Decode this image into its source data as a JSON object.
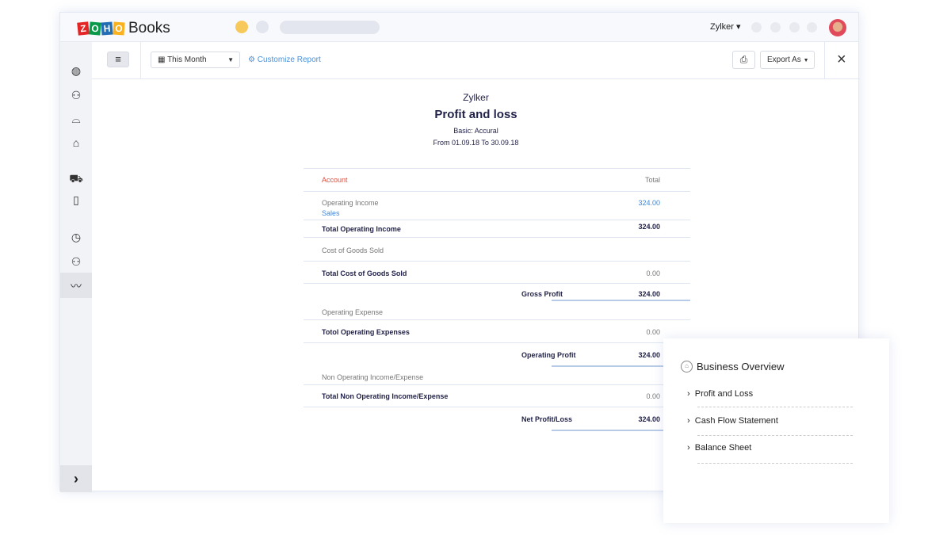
{
  "app": {
    "logo_letters": [
      "Z",
      "O",
      "H",
      "O"
    ],
    "logo_colors": [
      "#e42527",
      "#089949",
      "#226db4",
      "#f9b21d"
    ],
    "product": "Books",
    "org": "Zylker ▾"
  },
  "sidebar": {
    "icons": [
      "dashboard-icon",
      "contacts-icon",
      "items-icon",
      "banking-icon",
      "sales-cart-icon",
      "purchases-bag-icon",
      "time-tracking-icon",
      "accountant-icon",
      "reports-icon"
    ],
    "active": "reports-icon"
  },
  "toolbar": {
    "period": "This Month",
    "customize": "Customize Report",
    "export": "Export As",
    "print": "print-icon",
    "close": "×"
  },
  "report": {
    "company": "Zylker",
    "title": "Profit and loss",
    "basis": "Basic: Accural",
    "range": "From 01.09.18 To 30.09.18",
    "header": {
      "account": "Account",
      "total": "Total"
    },
    "rows": {
      "op_income": "Operating Income",
      "sales": "Sales",
      "sales_value": "324.00",
      "total_op_income": "Total Operating Income",
      "total_op_income_value": "324.00",
      "cogs": "Cost of Goods Sold",
      "total_cogs": "Total Cost of Goods Sold",
      "total_cogs_value": "0.00",
      "gross_profit": "Gross Profit",
      "gross_profit_value": "324.00",
      "op_expense": "Operating Expense",
      "total_op_exp": "Totol Operating Expenses",
      "total_op_exp_value": "0.00",
      "op_profit": "Operating Profit",
      "op_profit_value": "324.00",
      "non_op": "Non Operating Income/Expense",
      "total_non_op": "Total Non Operating Income/Expense",
      "total_non_op_value": "0.00",
      "net": "Net Profit/Loss",
      "net_value": "324.00"
    }
  },
  "overview": {
    "title": "Business Overview",
    "items": [
      "Profit and Loss",
      "Cash Flow Statement",
      "Balance Sheet"
    ]
  }
}
